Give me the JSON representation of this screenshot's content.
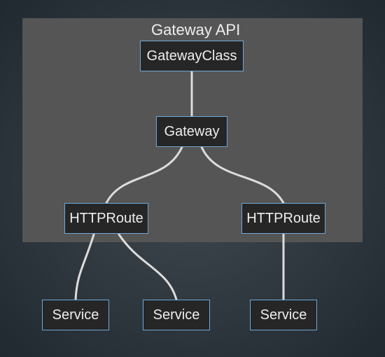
{
  "region": {
    "title": "Gateway API"
  },
  "nodes": {
    "gatewayClass": {
      "label": "GatewayClass"
    },
    "gateway": {
      "label": "Gateway"
    },
    "httpRoute1": {
      "label": "HTTPRoute"
    },
    "httpRoute2": {
      "label": "HTTPRoute"
    },
    "service1": {
      "label": "Service"
    },
    "service2": {
      "label": "Service"
    },
    "service3": {
      "label": "Service"
    }
  }
}
